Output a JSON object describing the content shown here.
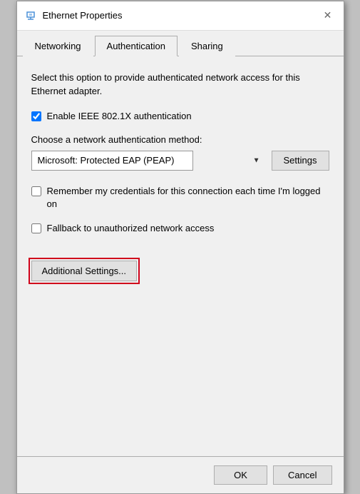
{
  "window": {
    "title": "Ethernet Properties",
    "icon": "network-icon",
    "close_label": "✕"
  },
  "tabs": [
    {
      "label": "Networking",
      "active": false
    },
    {
      "label": "Authentication",
      "active": true
    },
    {
      "label": "Sharing",
      "active": false
    }
  ],
  "content": {
    "description": "Select this option to provide authenticated network access for this Ethernet adapter.",
    "enable_checkbox": {
      "label": "Enable IEEE 802.1X authentication",
      "checked": true
    },
    "method_label": "Choose a network authentication method:",
    "method_value": "Microsoft: Protected EAP (PEAP)",
    "settings_button": "Settings",
    "remember_checkbox": {
      "label": "Remember my credentials for this connection each time I'm logged on",
      "checked": false
    },
    "fallback_checkbox": {
      "label": "Fallback to unauthorized network access",
      "checked": false
    },
    "additional_button": "Additional Settings..."
  },
  "footer": {
    "ok_label": "OK",
    "cancel_label": "Cancel"
  }
}
